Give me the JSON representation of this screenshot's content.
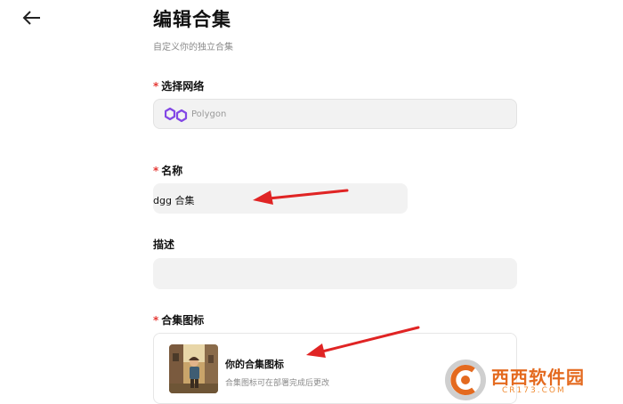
{
  "header": {
    "title": "编辑合集",
    "subtitle": "自定义你的独立合集"
  },
  "fields": {
    "network": {
      "label": "选择网络",
      "required_mark": "*",
      "value": "Polygon",
      "icon": "polygon-logo-icon"
    },
    "name": {
      "label": "名称",
      "required_mark": "*",
      "value": "dgg 合集"
    },
    "description": {
      "label": "描述",
      "value": ""
    },
    "collection_icon": {
      "label": "合集图标",
      "required_mark": "*",
      "title": "你的合集图标",
      "hint": "合集图标可在部署完成后更改"
    }
  },
  "annotations": {
    "arrow_color": "#e02424"
  },
  "watermark": {
    "text": "西西软件园",
    "sub": "CR173.COM",
    "icon": "cr173-logo-icon"
  },
  "colors": {
    "required": "#e53935",
    "polygon": "#8247e5",
    "field_bg": "#f2f2f2"
  }
}
